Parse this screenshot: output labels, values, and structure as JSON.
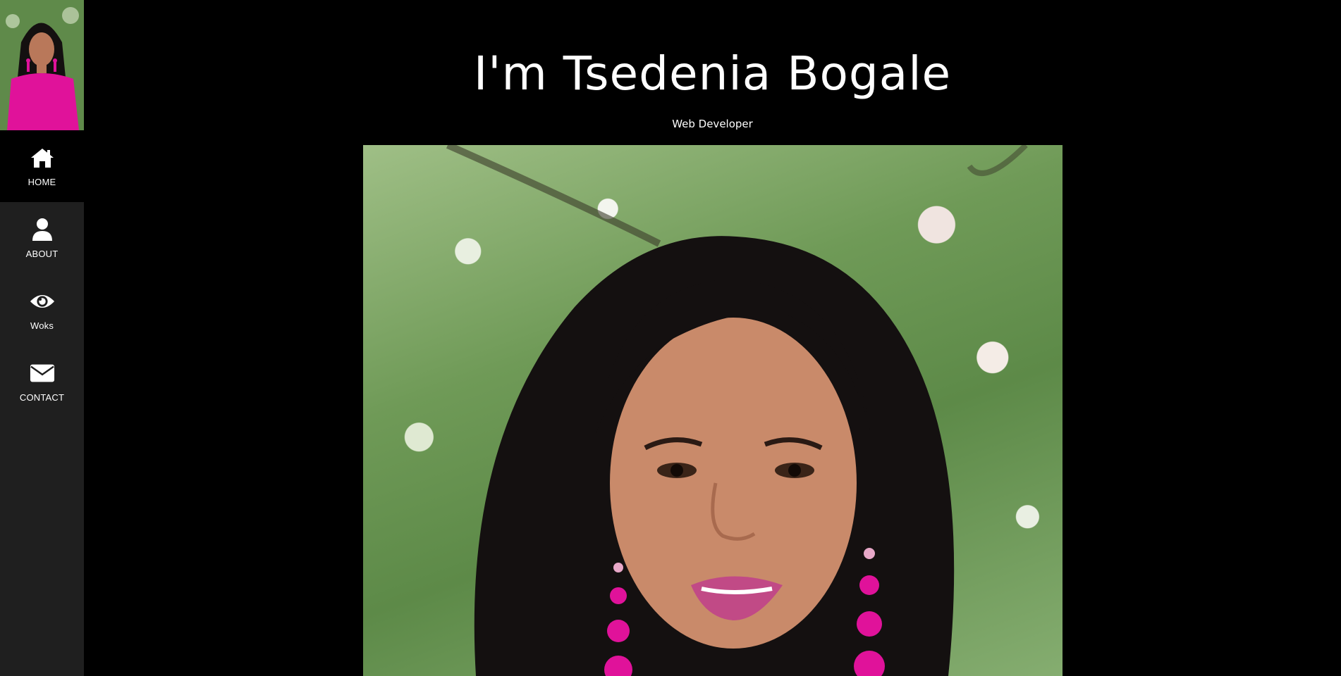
{
  "sidebar": {
    "items": [
      {
        "label": "HOME",
        "icon": "home-icon",
        "active": true
      },
      {
        "label": "ABOUT",
        "icon": "user-icon",
        "active": false
      },
      {
        "label": "Woks",
        "icon": "eye-icon",
        "active": false
      },
      {
        "label": "CONTACT",
        "icon": "envelope-icon",
        "active": false
      }
    ]
  },
  "hero": {
    "title": "I'm Tsedenia Bogale",
    "subtitle": "Web Developer"
  },
  "colors": {
    "background": "#000000",
    "sidebar": "#1f1f1f",
    "text": "#ffffff",
    "accent_pink": "#e0129a"
  }
}
